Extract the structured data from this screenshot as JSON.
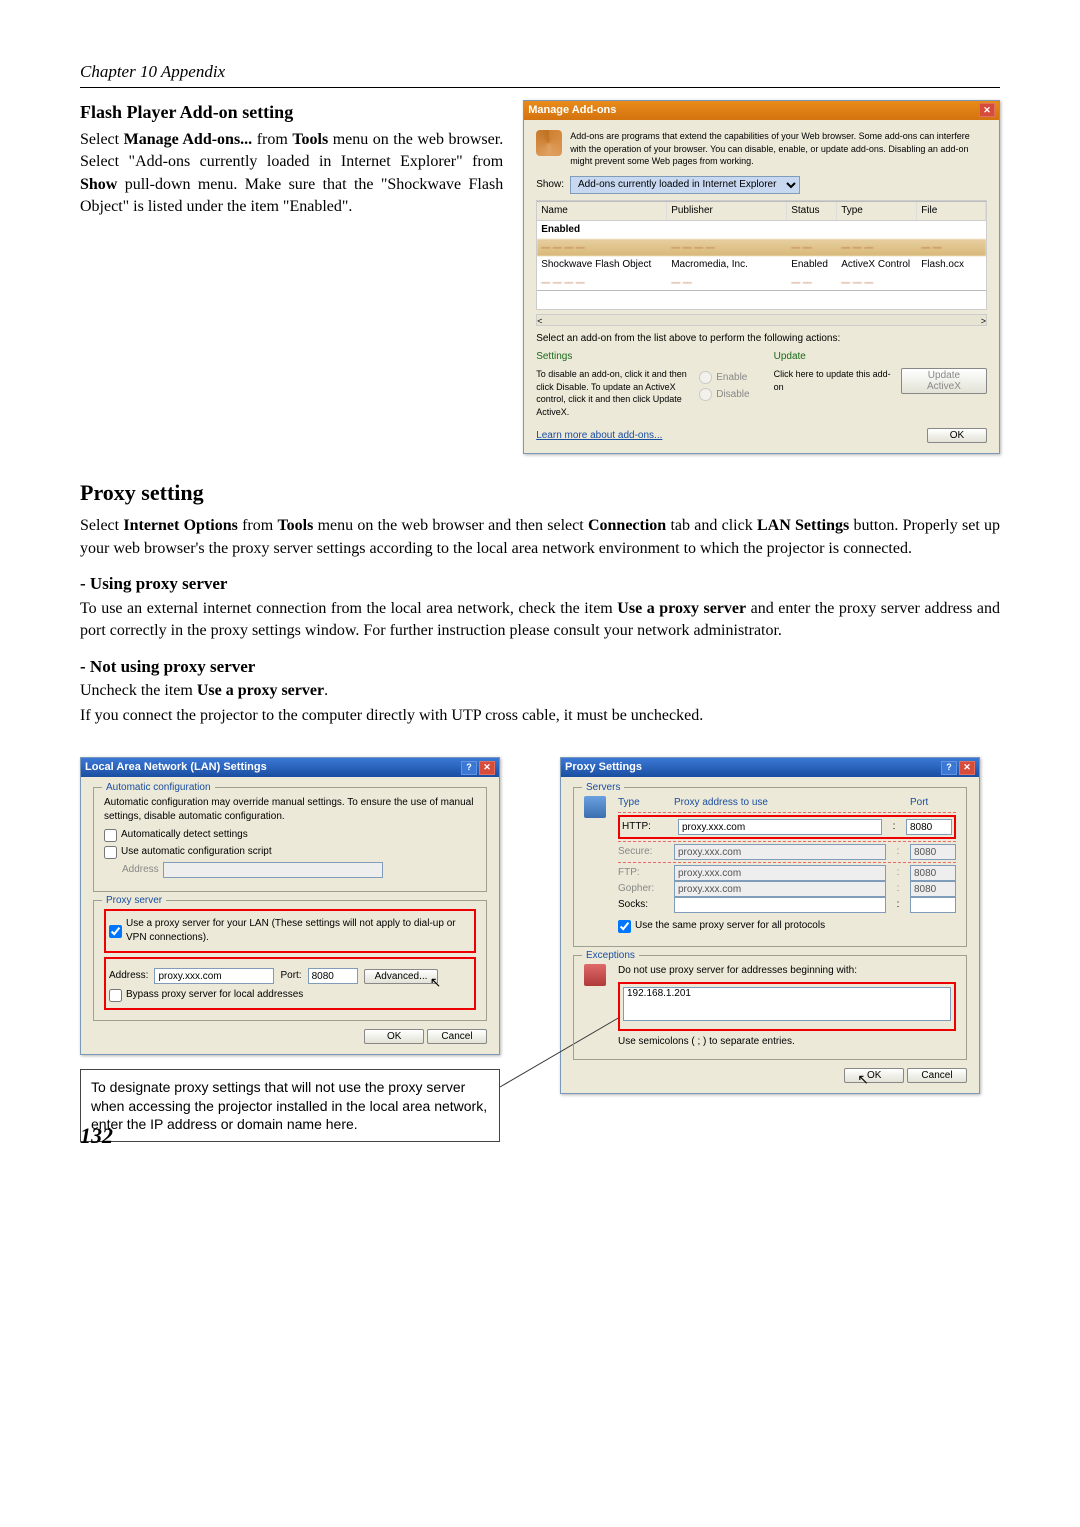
{
  "chapter": "Chapter 10 Appendix",
  "page_number": "132",
  "flash": {
    "heading": "Flash Player Add-on setting",
    "p1_a": "Select ",
    "p1_b": "Manage Add-ons...",
    "p1_c": " from ",
    "p1_d": "Tools",
    "p1_e": " menu on the web browser. Select \"Add-ons currently loaded in Internet Explorer\" from ",
    "p1_f": "Show",
    "p1_g": " pull-down menu. Make sure that the \"Shockwave Flash Object\" is listed under the item \"Enabled\"."
  },
  "addons_dlg": {
    "title": "Manage Add-ons",
    "desc": "Add-ons are programs that extend the capabilities of your Web browser. Some add-ons can interfere with the operation of your browser. You can disable, enable, or update add-ons. Disabling an add-on might prevent some Web pages from working.",
    "show_label": "Show:",
    "show_value": "Add-ons currently loaded in Internet Explorer",
    "col_name": "Name",
    "col_publisher": "Publisher",
    "col_status": "Status",
    "col_type": "Type",
    "col_file": "File",
    "group_enabled": "Enabled",
    "row_name": "Shockwave Flash Object",
    "row_pub": "Macromedia, Inc.",
    "row_status": "Enabled",
    "row_type": "ActiveX Control",
    "row_file": "Flash.ocx",
    "select_text": "Select an add-on from the list above to perform the following actions:",
    "settings_h": "Settings",
    "settings_p": "To disable an add-on, click it and then click Disable. To update an ActiveX control, click it and then click Update ActiveX.",
    "radio_enable": "Enable",
    "radio_disable": "Disable",
    "update_h": "Update",
    "update_p": "Click here to update this add-on",
    "update_btn": "Update ActiveX",
    "learn": "Learn more about add-ons...",
    "ok": "OK"
  },
  "proxy": {
    "heading": "Proxy setting",
    "p1_a": "Select ",
    "p1_b": "Internet Options",
    "p1_c": " from ",
    "p1_d": "Tools",
    "p1_e": " menu on the web browser and then select ",
    "p1_f": "Connection",
    "p1_g": " tab and click ",
    "p1_h": "LAN Settings",
    "p1_i": " button. Properly set up your web browser's the proxy server settings according to the local area network environment to which the projector is connected.",
    "using_h": "- Using proxy server",
    "using_p_a": "To use an external internet connection from the local area network, check the item ",
    "using_p_b": "Use a proxy server",
    "using_p_c": " and enter the proxy server address and port correctly in the proxy settings window. For further instruction please consult your network administrator.",
    "notusing_h": "- Not using proxy server",
    "notusing_p_a": "Uncheck the item ",
    "notusing_p_b": "Use a proxy server",
    "notusing_p_c": ".",
    "notusing_p2": "If you connect the projector to the computer directly with UTP cross cable, it must be unchecked."
  },
  "lan_dlg": {
    "title": "Local Area Network (LAN) Settings",
    "auto_h": "Automatic configuration",
    "auto_p": "Automatic configuration may override manual settings. To ensure the use of manual settings, disable automatic configuration.",
    "auto_detect": "Automatically detect settings",
    "auto_script": "Use automatic configuration script",
    "address_lbl": "Address",
    "proxy_h": "Proxy server",
    "use_proxy": "Use a proxy server for your LAN (These settings will not apply to dial-up or VPN connections).",
    "addr_lbl": "Address:",
    "addr_val": "proxy.xxx.com",
    "port_lbl": "Port:",
    "port_val": "8080",
    "advanced": "Advanced...",
    "bypass": "Bypass proxy server for local addresses",
    "ok": "OK",
    "cancel": "Cancel"
  },
  "proxy_dlg": {
    "title": "Proxy Settings",
    "servers_h": "Servers",
    "type_h": "Type",
    "addr_h": "Proxy address to use",
    "port_h": "Port",
    "http": "HTTP:",
    "secure": "Secure:",
    "ftp": "FTP:",
    "gopher": "Gopher:",
    "socks": "Socks:",
    "val_addr": "proxy.xxx.com",
    "val_port": "8080",
    "same": "Use the same proxy server for all protocols",
    "exc_h": "Exceptions",
    "exc_p": "Do not use proxy server for addresses beginning with:",
    "exc_val": "192.168.1.201",
    "exc_note": "Use semicolons ( ; ) to separate entries.",
    "ok": "OK",
    "cancel": "Cancel"
  },
  "note": "To designate proxy settings that will not use the proxy server when accessing the projector installed in the local area network, enter the IP address or domain name here."
}
